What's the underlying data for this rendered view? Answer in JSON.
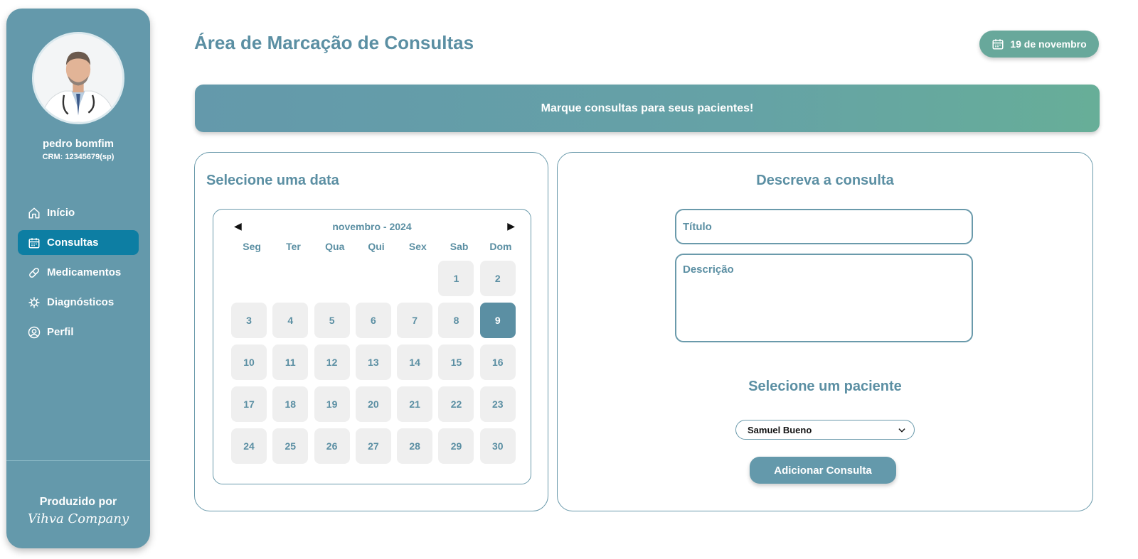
{
  "sidebar": {
    "user_name": "pedro bomfim",
    "crm": "CRM: 12345679(sp)",
    "items": [
      {
        "label": "Início",
        "icon": "home-icon"
      },
      {
        "label": "Consultas",
        "icon": "calendar-icon",
        "active": true
      },
      {
        "label": "Medicamentos",
        "icon": "pill-icon"
      },
      {
        "label": "Diagnósticos",
        "icon": "virus-icon"
      },
      {
        "label": "Perfil",
        "icon": "user-circle-icon"
      }
    ],
    "footer_label": "Produzido por",
    "footer_company": "Vihva Company"
  },
  "header": {
    "title": "Área de Marcação de Consultas",
    "date_badge": "19 de novembro"
  },
  "banner": {
    "text": "Marque consultas para seus pacientes!"
  },
  "calendar_card": {
    "title": "Selecione uma data",
    "month": "novembro - 2024",
    "prev": "◀",
    "next": "▶",
    "weekdays": [
      "Seg",
      "Ter",
      "Qua",
      "Qui",
      "Sex",
      "Sab",
      "Dom"
    ],
    "weeks": [
      [
        "",
        "",
        "",
        "",
        "",
        "1",
        "2"
      ],
      [
        "3",
        "4",
        "5",
        "6",
        "7",
        "8",
        "9"
      ],
      [
        "10",
        "11",
        "12",
        "13",
        "14",
        "15",
        "16"
      ],
      [
        "17",
        "18",
        "19",
        "20",
        "21",
        "22",
        "23"
      ],
      [
        "24",
        "25",
        "26",
        "27",
        "28",
        "29",
        "30"
      ]
    ],
    "selected_day": "9"
  },
  "form_card": {
    "title": "Descreva a consulta",
    "title_placeholder": "Título",
    "description_placeholder": "Descrição",
    "patient_heading": "Selecione um paciente",
    "patient_selected": "Samuel Bueno",
    "submit_label": "Adicionar Consulta"
  },
  "colors": {
    "primary": "#6499ab",
    "active_nav": "#0d7ea3",
    "accent_green": "#68a89b",
    "text": "#5b8fa3"
  }
}
